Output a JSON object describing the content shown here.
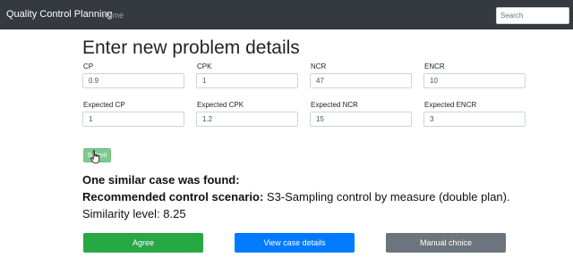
{
  "navbar": {
    "brand": "Quality Control Planning",
    "home": "Home",
    "search_placeholder": "Search"
  },
  "form": {
    "title": "Enter new problem details",
    "fields": [
      {
        "label": "CP",
        "value": "0.9"
      },
      {
        "label": "CPK",
        "value": "1"
      },
      {
        "label": "NCR",
        "value": "47"
      },
      {
        "label": "ENCR",
        "value": "10"
      },
      {
        "label": "Expected CP",
        "value": "1"
      },
      {
        "label": "Expected CPK",
        "value": "1.2"
      },
      {
        "label": "Expected NCR",
        "value": "15"
      },
      {
        "label": "Expected ENCR",
        "value": "3"
      }
    ],
    "submit_label": "Submit"
  },
  "result": {
    "found_text": "One similar case was found:",
    "scenario_label": "Recommended control scenario:",
    "scenario_value": " S3-Sampling control by measure (double plan).",
    "similarity_text": "Similarity level: 8.25"
  },
  "actions": {
    "agree": "Agree",
    "view": "View case details",
    "manual": "Manual choice"
  },
  "colors": {
    "navbar": "#343a40",
    "agree": "#28a745",
    "view": "#007bff",
    "manual": "#6c757d",
    "submit": "#7ec98f"
  },
  "icons": {
    "cursor": "hand-pointer-icon"
  }
}
